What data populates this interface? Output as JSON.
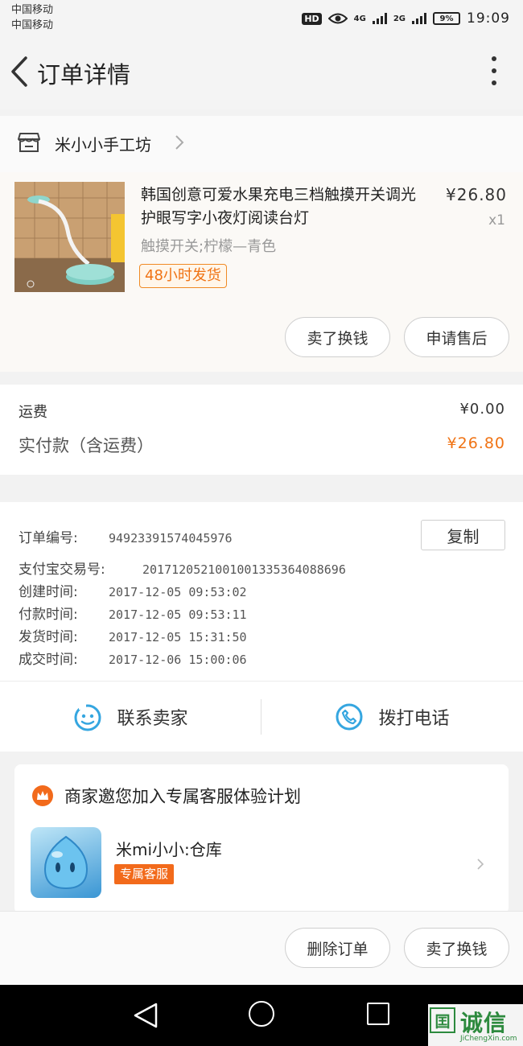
{
  "status_bar": {
    "carrier_1": "中国移动",
    "carrier_2": "中国移动",
    "hd_badge": "HD",
    "net_1": "4G",
    "net_2": "2G",
    "battery": "9%",
    "time": "19:09"
  },
  "app_bar": {
    "title": "订单详情"
  },
  "shop": {
    "name": "米小小手工坊"
  },
  "item": {
    "title": "韩国创意可爱水果充电三档触摸开关调光护眼写字小夜灯阅读台灯",
    "price": "¥26.80",
    "quantity": "x1",
    "sku": "触摸开关;柠檬—青色",
    "shipping_tag": "48小时发货",
    "sell_button": "卖了换钱",
    "aftersale_button": "申请售后"
  },
  "summary": {
    "freight_label": "运费",
    "freight_value": "¥0.00",
    "paid_label": "实付款（含运费）",
    "paid_value": "¥26.80"
  },
  "order_info": {
    "copy_button": "复制",
    "rows": [
      {
        "label": "订单编号:",
        "value": "94923391574045976"
      },
      {
        "label": "支付宝交易号:",
        "value": "2017120521001001335364088696"
      },
      {
        "label": "创建时间:",
        "value": "2017-12-05 09:53:02"
      },
      {
        "label": "付款时间:",
        "value": "2017-12-05 09:53:11"
      },
      {
        "label": "发货时间:",
        "value": "2017-12-05 15:31:50"
      },
      {
        "label": "成交时间:",
        "value": "2017-12-06 15:00:06"
      }
    ]
  },
  "contact": {
    "seller_label": "联系卖家",
    "phone_label": "拨打电话"
  },
  "service": {
    "title": "商家邀您加入专属客服体验计划",
    "name": "米mi小小:仓库",
    "tag": "专属客服"
  },
  "bottom_actions": {
    "delete_button": "删除订单",
    "sell_button": "卖了换钱"
  },
  "watermark": {
    "name": "诚信",
    "url": "JiChengXin.com"
  },
  "colors": {
    "accent_orange": "#f07314",
    "service_orange": "#f26a1b",
    "icon_blue": "#35a6e0"
  }
}
